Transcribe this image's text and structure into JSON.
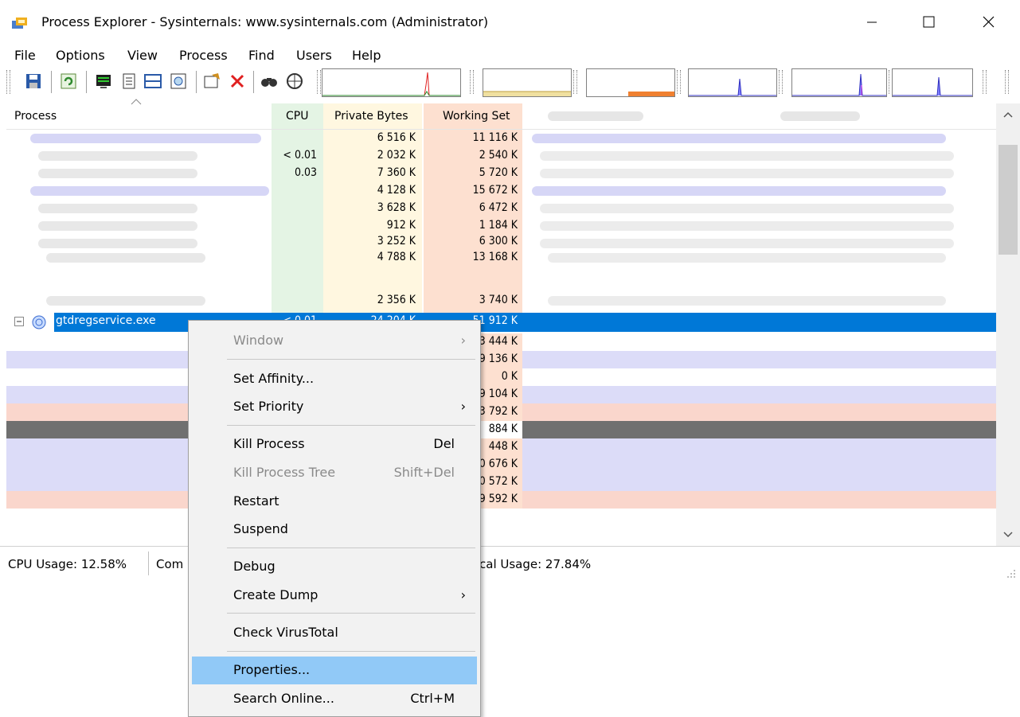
{
  "window": {
    "title": "Process Explorer - Sysinternals: www.sysinternals.com (Administrator)",
    "minimize_glyph": "—",
    "maximize_glyph": "☐",
    "close_glyph": "✕"
  },
  "menubar": [
    "File",
    "Options",
    "View",
    "Process",
    "Find",
    "Users",
    "Help"
  ],
  "columns": {
    "process": "Process",
    "cpu": "CPU",
    "private_bytes": "Private Bytes",
    "working_set": "Working Set"
  },
  "colors": {
    "cpu_col": "#e4f4e4",
    "private_col": "#fff7e0",
    "working_col": "#fde0d0",
    "selected": "#0078d7",
    "service_row": "#d0d0ff",
    "suspended_row": "#ffd0d0",
    "menu_highlight": "#91c9f7"
  },
  "rows": [
    {
      "cpu": "",
      "private": "6 516 K",
      "working": "11 116 K"
    },
    {
      "cpu": "< 0.01",
      "private": "2 032 K",
      "working": "2 540 K"
    },
    {
      "cpu": "0.03",
      "private": "7 360 K",
      "working": "5 720 K"
    },
    {
      "cpu": "",
      "private": "4 128 K",
      "working": "15 672 K"
    },
    {
      "cpu": "",
      "private": "3 628 K",
      "working": "6 472 K"
    },
    {
      "cpu": "",
      "private": "912 K",
      "working": "1 184 K"
    },
    {
      "cpu": "",
      "private": "3 252 K",
      "working": "6 300 K"
    },
    {
      "cpu": "",
      "private": "4 788 K",
      "working": "13 168 K"
    },
    {
      "cpu": "",
      "private": "2 356 K",
      "working": "3 740 K"
    }
  ],
  "selected_row": {
    "name": "gtdregservice.exe",
    "cpu": "< 0.01",
    "private": "24 204 K",
    "working": "51 912 K"
  },
  "partial_working": [
    "3 444 K",
    "9 136 K",
    "0 K",
    "9 104 K",
    "3 792 K",
    "884 K",
    "448 K",
    "0 676 K",
    "0 572 K",
    "9 592 K"
  ],
  "statusbar": {
    "cpu_usage": "CPU Usage: 12.58%",
    "commit_partial": "Com",
    "physical_partial": "cal Usage: 27.84%"
  },
  "context_menu": {
    "items": [
      {
        "label": "Window",
        "shortcut": "",
        "submenu": true,
        "disabled": true
      },
      {
        "label": "Set Affinity...",
        "shortcut": "",
        "submenu": false,
        "disabled": false
      },
      {
        "label": "Set Priority",
        "shortcut": "",
        "submenu": true,
        "disabled": false
      },
      {
        "label": "Kill Process",
        "shortcut": "Del",
        "submenu": false,
        "disabled": false
      },
      {
        "label": "Kill Process Tree",
        "shortcut": "Shift+Del",
        "submenu": false,
        "disabled": true
      },
      {
        "label": "Restart",
        "shortcut": "",
        "submenu": false,
        "disabled": false
      },
      {
        "label": "Suspend",
        "shortcut": "",
        "submenu": false,
        "disabled": false
      },
      {
        "label": "Debug",
        "shortcut": "",
        "submenu": false,
        "disabled": false
      },
      {
        "label": "Create Dump",
        "shortcut": "",
        "submenu": true,
        "disabled": false
      },
      {
        "label": "Check VirusTotal",
        "shortcut": "",
        "submenu": false,
        "disabled": false
      },
      {
        "label": "Properties...",
        "shortcut": "",
        "submenu": false,
        "disabled": false,
        "highlighted": true
      },
      {
        "label": "Search Online...",
        "shortcut": "Ctrl+M",
        "submenu": false,
        "disabled": false
      }
    ],
    "submenu_arrow": "›"
  }
}
